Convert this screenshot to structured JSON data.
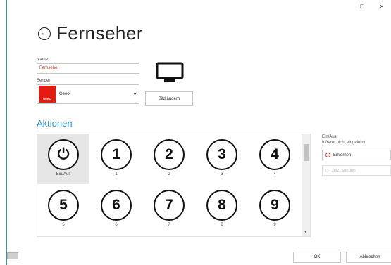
{
  "window": {
    "restore_glyph": "□",
    "close_glyph": "×"
  },
  "header": {
    "title": "Fernseher",
    "back_icon": "back-arrow-circle-icon"
  },
  "form": {
    "name_label": "Name",
    "name_value": "Fernseher",
    "sender_label": "Sender",
    "sender_value": "Geeo",
    "sender_logo_text": "GEEO",
    "change_image_label": "Bild ändern"
  },
  "actions": {
    "section_title": "Aktionen",
    "items": [
      {
        "glyph": "⏻",
        "label": "Ein/Aus",
        "selected": true
      },
      {
        "glyph": "1",
        "label": "1"
      },
      {
        "glyph": "2",
        "label": "2"
      },
      {
        "glyph": "3",
        "label": "3"
      },
      {
        "glyph": "4",
        "label": "4"
      },
      {
        "glyph": "5",
        "label": "5"
      },
      {
        "glyph": "6",
        "label": "6"
      },
      {
        "glyph": "7",
        "label": "7"
      },
      {
        "glyph": "8",
        "label": "8"
      },
      {
        "glyph": "9",
        "label": "9"
      }
    ]
  },
  "detail": {
    "title": "Ein/Aus",
    "subtitle": "Infrarot nicht eingelernt.",
    "learn_label": "Einlernen",
    "send_label": "Jetzt senden"
  },
  "footer": {
    "ok_label": "OK",
    "cancel_label": "Abbrechen"
  },
  "colors": {
    "accent": "#2a8fd6",
    "logo_red": "#e41b13"
  }
}
